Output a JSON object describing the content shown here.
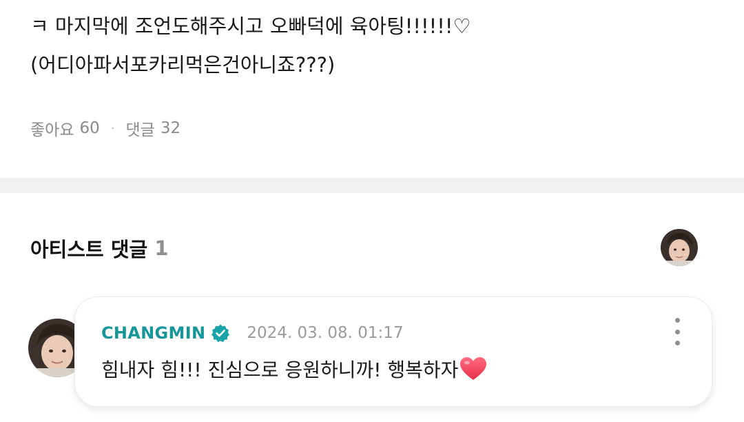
{
  "post": {
    "lines": [
      "ㅋ 마지막에 조언도해주시고 오빠덕에 육아팅!!!!!!♡",
      "(어디아파서포카리먹은건아니죠???)"
    ]
  },
  "stats": {
    "likes_label": "좋아요",
    "likes_count": "60",
    "separator": "·",
    "comments_label": "댓글",
    "comments_count": "32"
  },
  "artist_comments": {
    "title": "아티스트 댓글",
    "count": "1"
  },
  "comment": {
    "author": "CHANGMIN",
    "timestamp": "2024. 03. 08. 01:17",
    "text": "힘내자 힘!!! 진심으로 응원하니까! 행복하자"
  },
  "colors": {
    "author": "#17969a",
    "verified": "#17a3a8",
    "heart": "#f0465c"
  },
  "icons": {
    "verified": "verified-badge-icon",
    "heart": "red-heart-icon",
    "more": "more-vertical-icon"
  }
}
